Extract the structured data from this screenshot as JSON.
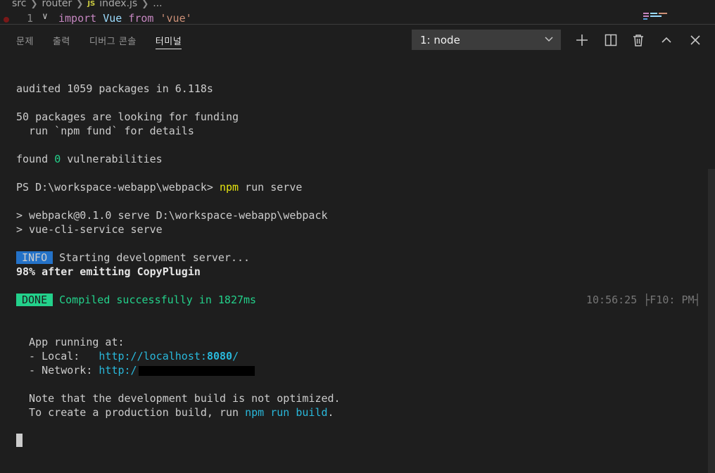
{
  "editor": {
    "breadcrumb": [
      "src",
      "router",
      "index.js",
      "..."
    ],
    "js_badge": "JS",
    "line_number": "1",
    "code": {
      "kw": "import",
      "id": "Vue",
      "from": "from",
      "str": "'vue'"
    }
  },
  "panel": {
    "tabs": [
      "문제",
      "출력",
      "디버그 콘솔",
      "터미널"
    ],
    "active_tab": "터미널",
    "terminal_select": "1: node"
  },
  "terminal": {
    "l1": "audited 1059 packages in 6.118s",
    "l2": "50 packages are looking for funding",
    "l3": "  run `npm fund` for details",
    "l4a": "found ",
    "l4b": "0",
    "l4c": " vulnerabilities",
    "l5a": "PS D:\\workspace-webapp\\webpack> ",
    "l5b": "npm",
    "l5c": " run serve",
    "l6": "> webpack@0.1.0 serve D:\\workspace-webapp\\webpack",
    "l7": "> vue-cli-service serve",
    "info_badge": "INFO",
    "l8": "Starting development server...",
    "l9": "98% after emitting CopyPlugin",
    "done_badge": "DONE",
    "l10": "Compiled successfully in 1827ms",
    "timestamp": "10:56:25 ├F10: PM┤",
    "l11": "  App running at:",
    "l12a": "  - Local:   ",
    "l12b": "http://localhost:",
    "l12c": "8080",
    "l12d": "/",
    "l13a": "  - Network: ",
    "l13b": "http:/",
    "l14": "  Note that the development build is not optimized.",
    "l15a": "  To create a production build, run ",
    "l15b": "npm run build",
    "l15c": "."
  },
  "colors": {
    "success": "#23d18b",
    "info": "#2472c8",
    "link": "#29b8db",
    "command": "#e5e510"
  }
}
